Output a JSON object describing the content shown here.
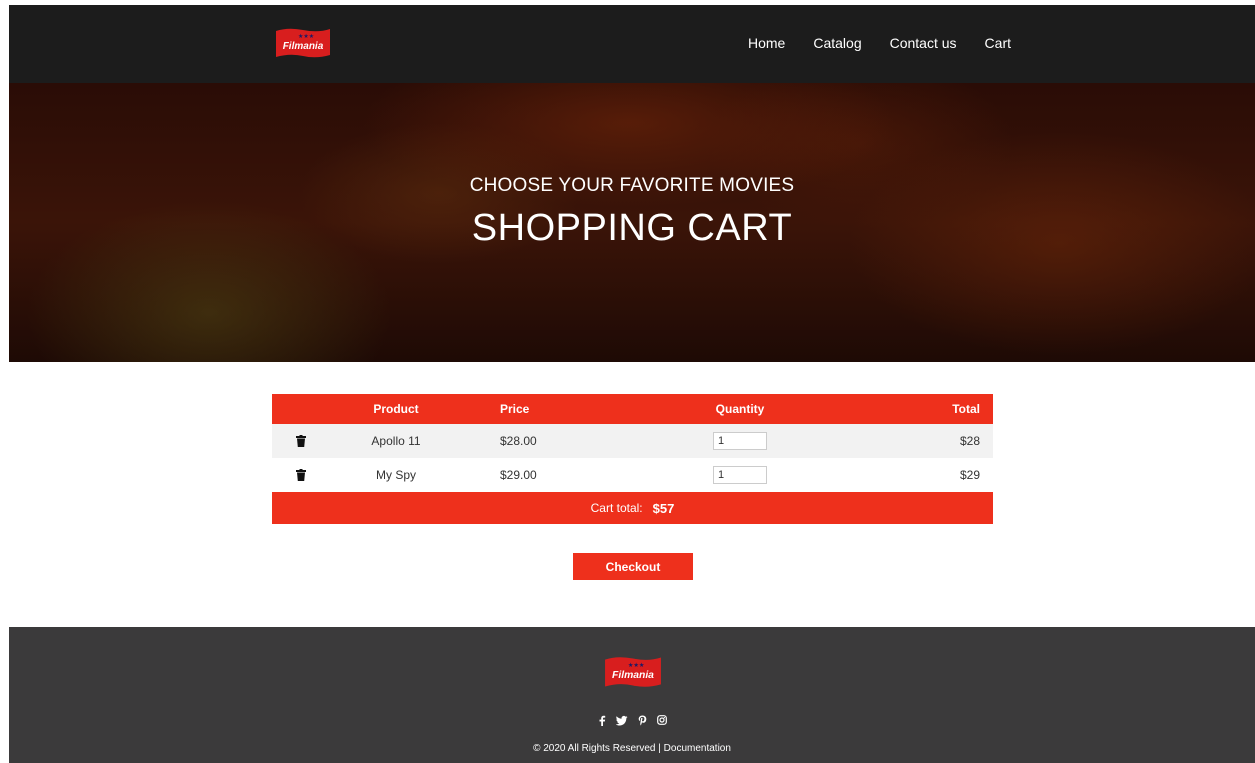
{
  "brand": {
    "name": "Filmania",
    "accent": "#ee301c"
  },
  "nav": {
    "items": [
      "Home",
      "Catalog",
      "Contact us",
      "Cart"
    ]
  },
  "hero": {
    "subtitle": "CHOOSE YOUR FAVORITE MOVIES",
    "title": "SHOPPING CART"
  },
  "cart": {
    "headers": {
      "product": "Product",
      "price": "Price",
      "quantity": "Quantity",
      "total": "Total"
    },
    "rows": [
      {
        "product": "Apollo 11",
        "price": "$28.00",
        "quantity": "1",
        "total": "$28"
      },
      {
        "product": "My Spy",
        "price": "$29.00",
        "quantity": "1",
        "total": "$29"
      }
    ],
    "total_label": "Cart total:",
    "total_value": "$57"
  },
  "checkout": {
    "label": "Checkout"
  },
  "footer": {
    "socials": [
      "facebook-icon",
      "twitter-icon",
      "pinterest-icon",
      "instagram-icon"
    ],
    "copyright": "© 2020 All Rights Reserved",
    "separator": "|",
    "doc_link": "Documentation"
  }
}
